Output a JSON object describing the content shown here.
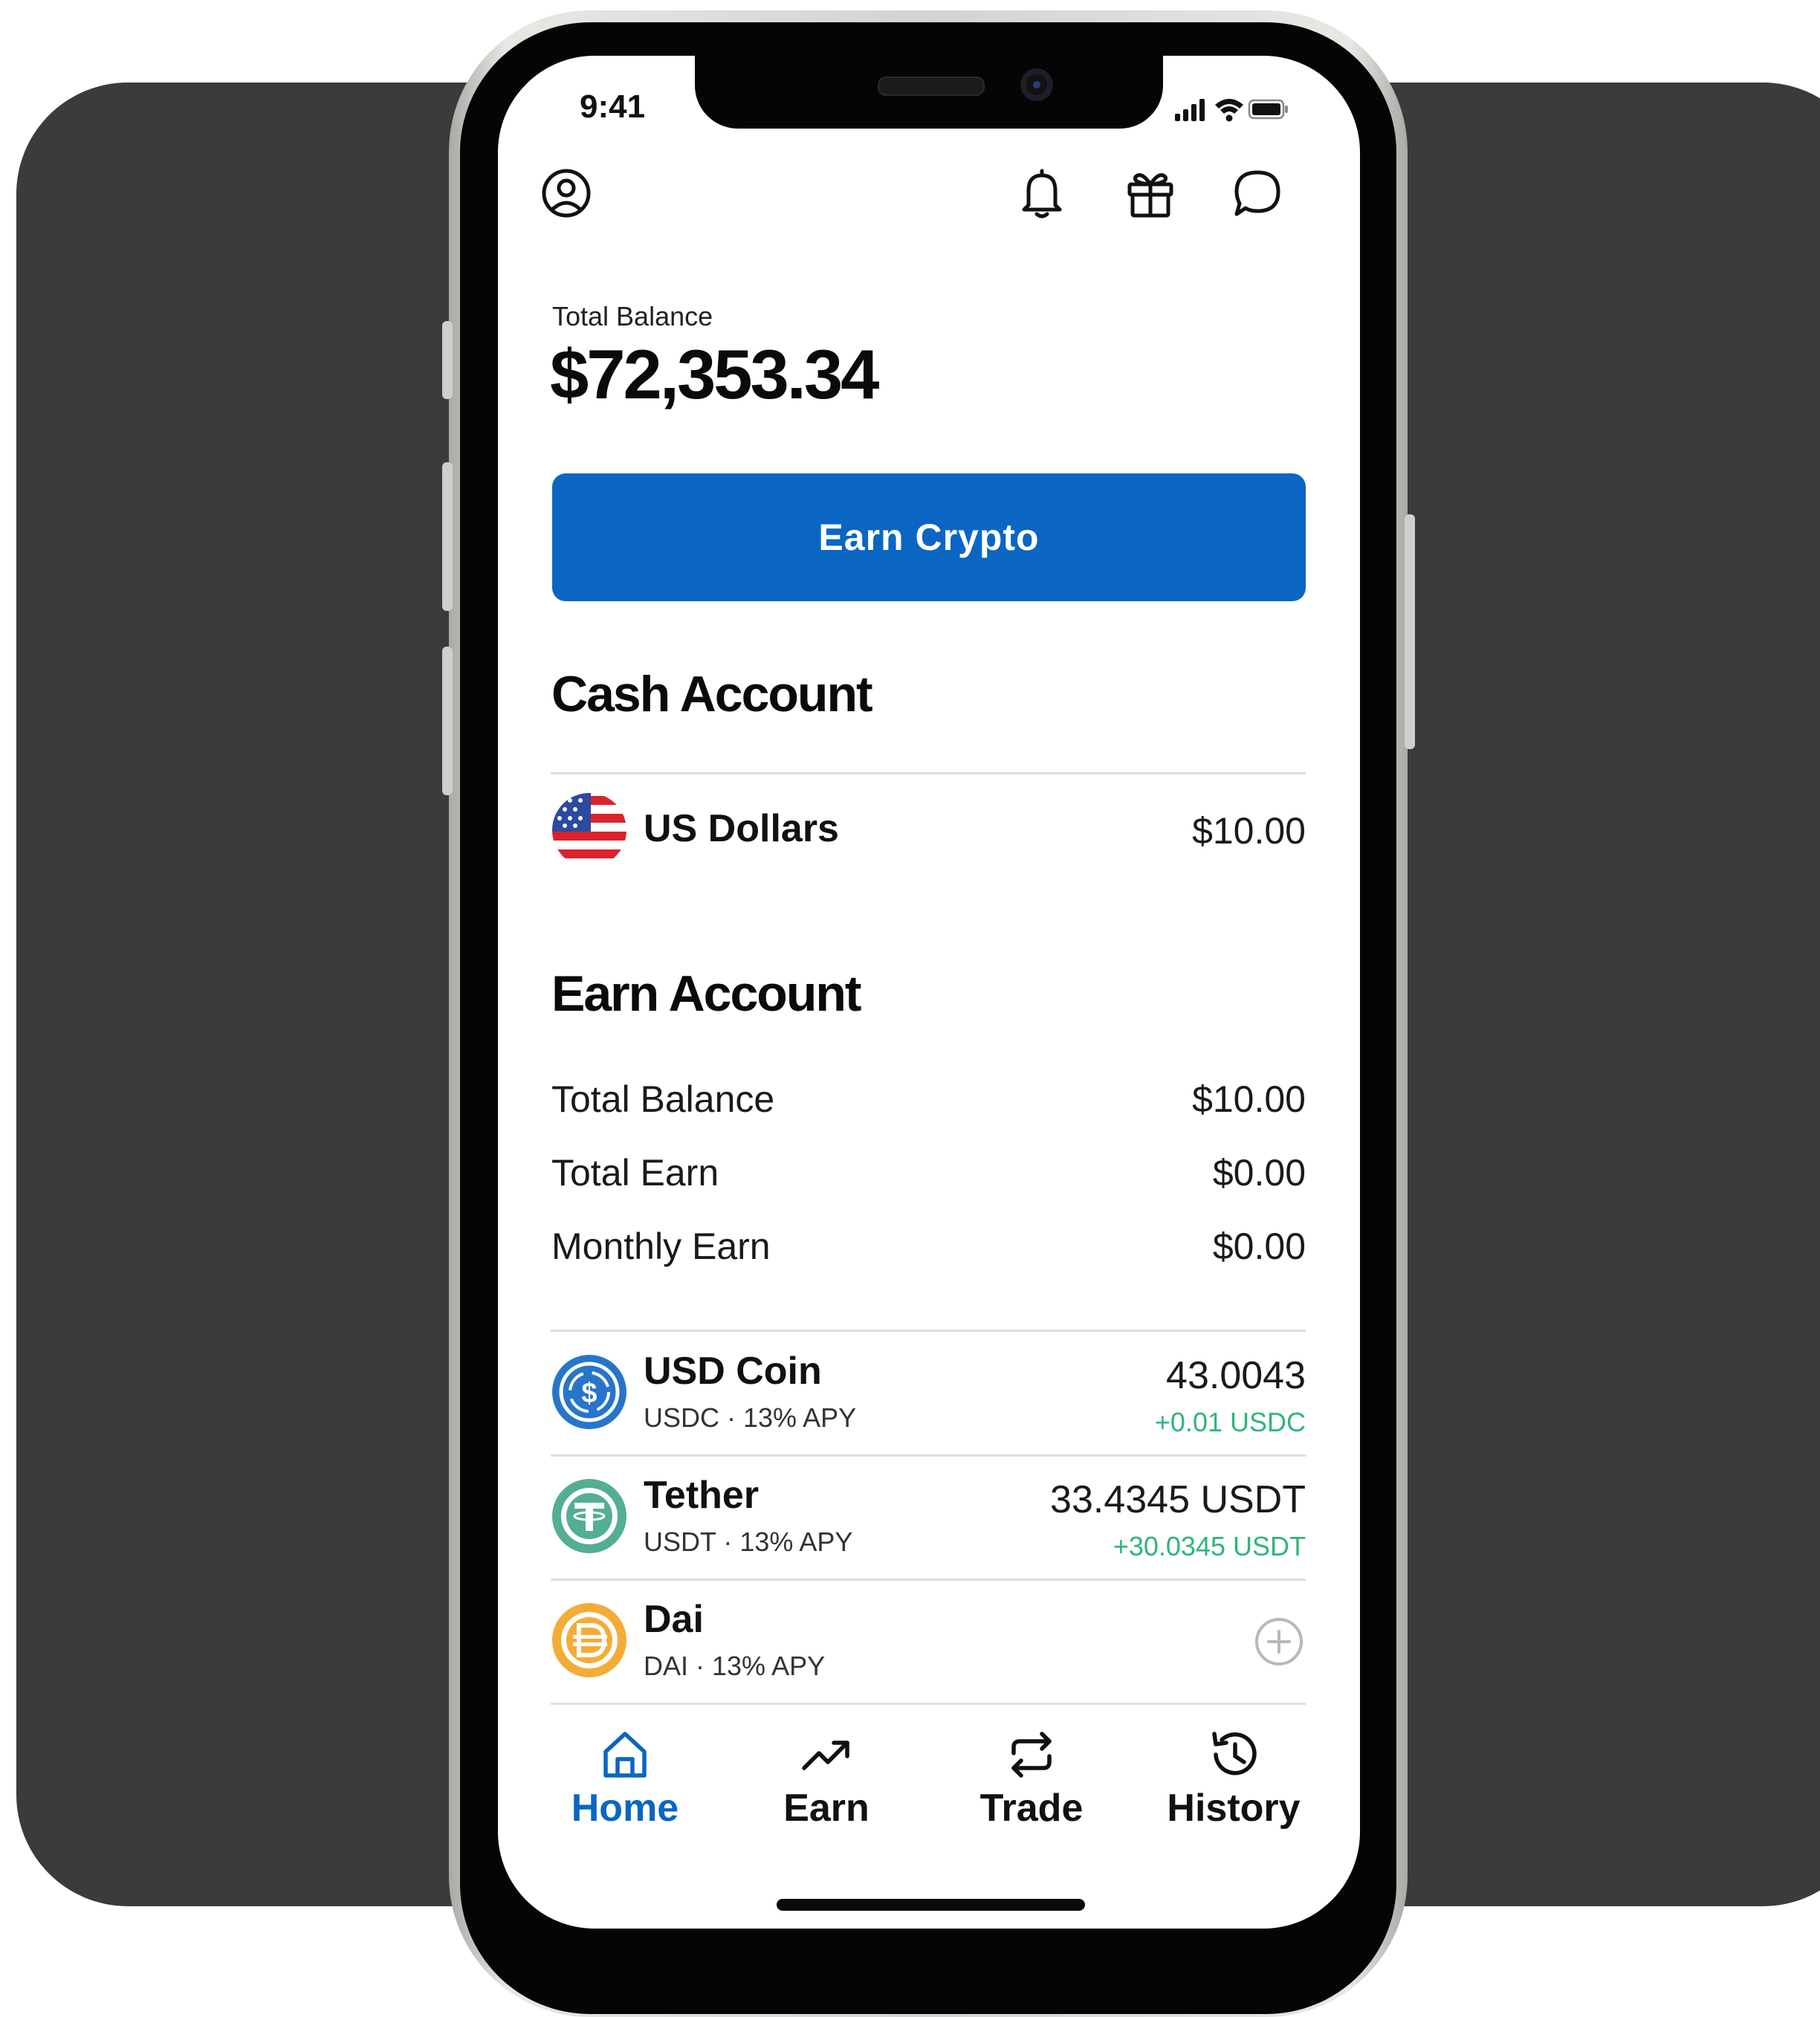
{
  "status_bar": {
    "time": "9:41"
  },
  "header": {
    "icons": [
      "profile-icon",
      "bell-icon",
      "gift-icon",
      "chat-icon"
    ]
  },
  "balance": {
    "label": "Total Balance",
    "value": "$72,353.34"
  },
  "cta": {
    "label": "Earn Crypto",
    "color": "#0a66c2"
  },
  "cash_account": {
    "title": "Cash Account",
    "items": [
      {
        "name": "US Dollars",
        "value": "$10.00",
        "icon": "us-flag-icon"
      }
    ]
  },
  "earn_account": {
    "title": "Earn Account",
    "summary": [
      {
        "label": "Total Balance",
        "value": "$10.00"
      },
      {
        "label": "Total Earn",
        "value": "$0.00"
      },
      {
        "label": "Monthly Earn",
        "value": "$0.00"
      }
    ],
    "assets": [
      {
        "name": "USD Coin",
        "sub": "USDC · 13% APY",
        "amount": "43.0043",
        "gain": "+0.01 USDC",
        "icon": "usdc-coin-icon",
        "color": "#2775ca"
      },
      {
        "name": "Tether",
        "sub": "USDT · 13% APY",
        "amount": "33.4345 USDT",
        "gain": "+30.0345 USDT",
        "icon": "tether-coin-icon",
        "color": "#53ae94"
      },
      {
        "name": "Dai",
        "sub": "DAI · 13% APY",
        "amount": "",
        "gain": "",
        "icon": "dai-coin-icon",
        "color": "#f5ac37"
      }
    ],
    "gain_color": "#2fb57a"
  },
  "nav": {
    "active": "Home",
    "items": [
      {
        "label": "Home",
        "icon": "home-icon"
      },
      {
        "label": "Earn",
        "icon": "trending-up-icon"
      },
      {
        "label": "Trade",
        "icon": "swap-icon"
      },
      {
        "label": "History",
        "icon": "history-icon"
      }
    ]
  }
}
